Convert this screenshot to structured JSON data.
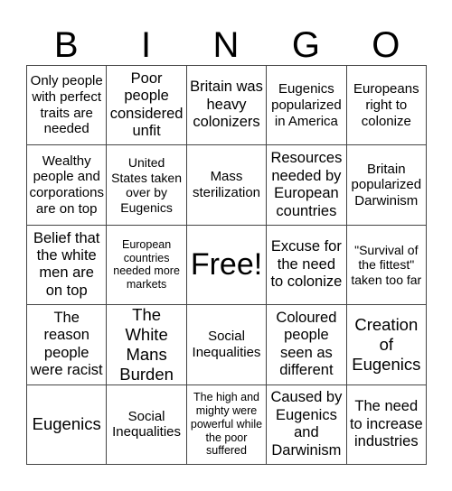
{
  "header": {
    "letters": [
      "B",
      "I",
      "N",
      "G",
      "O"
    ]
  },
  "board": {
    "rows": [
      [
        {
          "text": "Only people with perfect traits are needed",
          "size": "md"
        },
        {
          "text": "Poor people considered unfit",
          "size": "lg"
        },
        {
          "text": "Britain was heavy colonizers",
          "size": "lg"
        },
        {
          "text": "Eugenics popularized in America",
          "size": "md"
        },
        {
          "text": "Europeans right to colonize",
          "size": "md"
        }
      ],
      [
        {
          "text": "Wealthy people and corporations are on top",
          "size": "md"
        },
        {
          "text": "United States taken over by Eugenics",
          "size": "sm"
        },
        {
          "text": "Mass sterilization",
          "size": "md"
        },
        {
          "text": "Resources needed by European countries",
          "size": "lg"
        },
        {
          "text": "Britain popularized Darwinism",
          "size": "md"
        }
      ],
      [
        {
          "text": "Belief that the white men are on top",
          "size": "lg"
        },
        {
          "text": "European countries needed more markets",
          "size": "xs"
        },
        {
          "text": "Free!",
          "size": "free"
        },
        {
          "text": "Excuse for the need to colonize",
          "size": "lg"
        },
        {
          "text": "\"Survival of the fittest\" taken too far",
          "size": "sm"
        }
      ],
      [
        {
          "text": "The reason people were racist",
          "size": "lg"
        },
        {
          "text": "The White Mans Burden",
          "size": "xl"
        },
        {
          "text": "Social Inequalities",
          "size": "md"
        },
        {
          "text": "Coloured people seen as different",
          "size": "lg"
        },
        {
          "text": "Creation of Eugenics",
          "size": "xl"
        }
      ],
      [
        {
          "text": "Eugenics",
          "size": "xl"
        },
        {
          "text": "Social Inequalities",
          "size": "md"
        },
        {
          "text": "The high and mighty were powerful while the poor suffered",
          "size": "xs"
        },
        {
          "text": "Caused by Eugenics and Darwinism",
          "size": "lg"
        },
        {
          "text": "The need to increase industries",
          "size": "lg"
        }
      ]
    ]
  }
}
